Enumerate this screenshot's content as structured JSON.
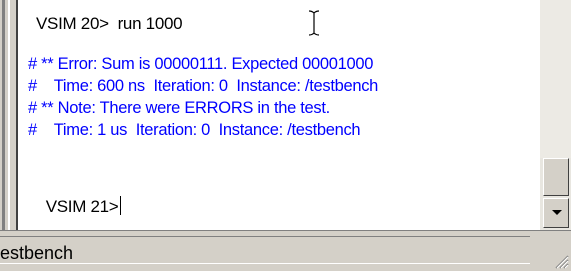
{
  "console": {
    "lines": [
      {
        "text": "VSIM 20>  run 1000"
      },
      {
        "text": "# ** Error: Sum is 00000111. Expected 00001000"
      },
      {
        "text": "#    Time: 600 ns  Iteration: 0  Instance: /testbench"
      },
      {
        "text": "# ** Note: There were ERRORS in the test."
      },
      {
        "text": "#    Time: 1 us  Iteration: 0  Instance: /testbench"
      },
      {
        "text": "VSIM 21>"
      }
    ]
  },
  "status_bar": {
    "text": "estbench"
  },
  "colors": {
    "output_text": "#0000ff",
    "prompt_text": "#000000",
    "background": "#ffffff",
    "chrome": "#d4d0c8"
  },
  "icons": {
    "text_cursor": "i-beam-icon",
    "scroll_down": "chevron-down-icon",
    "resize": "resize-grip-icon"
  }
}
